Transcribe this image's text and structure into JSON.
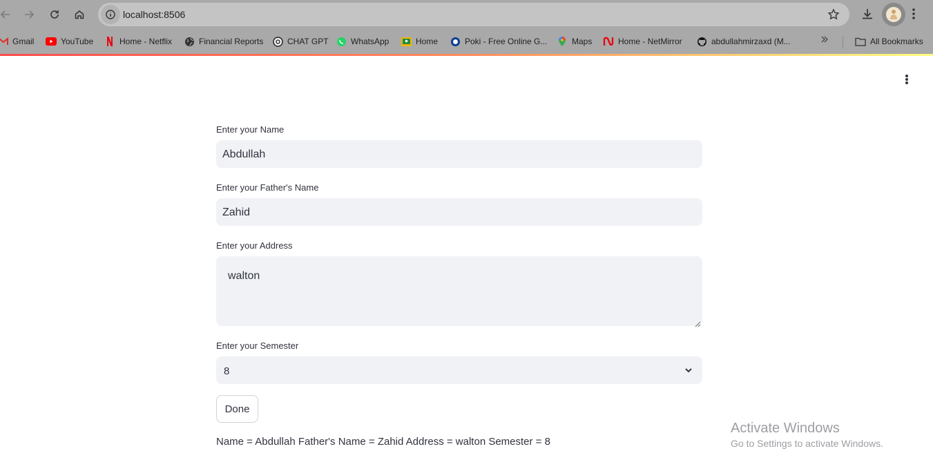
{
  "browser": {
    "url": "localhost:8506",
    "bookmarks": [
      {
        "label": "Gmail",
        "icon": "gmail-icon"
      },
      {
        "label": "YouTube",
        "icon": "youtube-icon"
      },
      {
        "label": "Home - Netflix",
        "icon": "netflix-icon"
      },
      {
        "label": "Financial Reports",
        "icon": "globe-icon"
      },
      {
        "label": "CHAT GPT",
        "icon": "chatgpt-icon"
      },
      {
        "label": "WhatsApp",
        "icon": "whatsapp-icon"
      },
      {
        "label": "Home",
        "icon": "classroom-icon"
      },
      {
        "label": "Poki - Free Online G...",
        "icon": "poki-icon"
      },
      {
        "label": "Maps",
        "icon": "maps-icon"
      },
      {
        "label": "Home - NetMirror",
        "icon": "netmirror-icon"
      },
      {
        "label": "abdullahmirzaxd (M...",
        "icon": "github-icon"
      }
    ],
    "all_bookmarks_label": "All Bookmarks"
  },
  "form": {
    "name_label": "Enter your Name",
    "name_value": "Abdullah",
    "father_label": "Enter your Father's Name",
    "father_value": "Zahid",
    "address_label": "Enter your Address",
    "address_value": "walton",
    "semester_label": "Enter your Semester",
    "semester_value": "8",
    "done_label": "Done"
  },
  "output": "Name = Abdullah Father's Name = Zahid Address = walton Semester = 8",
  "watermark": {
    "title": "Activate Windows",
    "subtitle": "Go to Settings to activate Windows."
  },
  "colors": {
    "accent_red": "#ff4b4b",
    "input_bg": "#f0f2f6",
    "text": "#31333f"
  }
}
